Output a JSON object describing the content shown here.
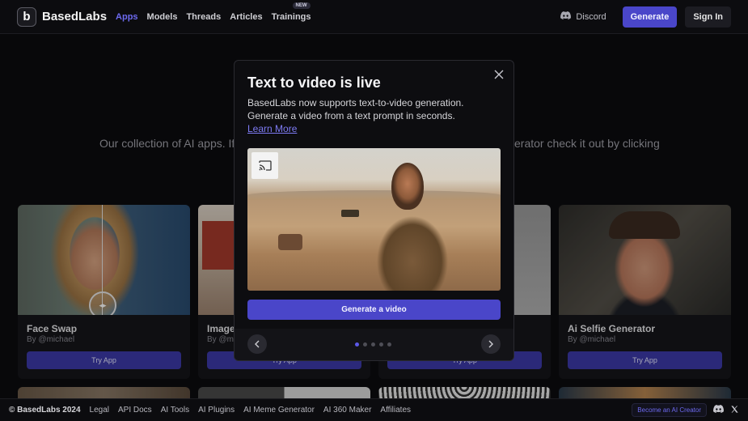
{
  "brand": {
    "name": "BasedLabs"
  },
  "nav": {
    "items": [
      {
        "label": "Apps",
        "active": true
      },
      {
        "label": "Models"
      },
      {
        "label": "Threads"
      },
      {
        "label": "Articles"
      },
      {
        "label": "Trainings",
        "badge": "NEW"
      }
    ]
  },
  "header_actions": {
    "discord": "Discord",
    "generate": "Generate",
    "signin": "Sign In"
  },
  "intro": {
    "left_text": "Our collection of AI apps. If y",
    "right_text": "erator check it out by clicking"
  },
  "cards": [
    {
      "title": "Face Swap",
      "author": "By @michael",
      "button": "Try App"
    },
    {
      "title": "Image",
      "author": "By @mi",
      "button": "Try App"
    },
    {
      "title": "",
      "author": "",
      "button": "Try App"
    },
    {
      "title": "Ai Selfie Generator",
      "author": "By @michael",
      "button": "Try App"
    }
  ],
  "modal": {
    "title": "Text to video is live",
    "description": "BasedLabs now supports text-to-video generation. Generate a video from a text prompt in seconds.",
    "learn_more": "Learn More",
    "cta": "Generate a video",
    "slides_total": 5,
    "slide_active": 1
  },
  "footer": {
    "copyright": "© BasedLabs 2024",
    "links": [
      "Legal",
      "API Docs",
      "AI Tools",
      "AI Plugins",
      "AI Meme Generator",
      "AI 360 Maker",
      "Affiliates"
    ],
    "creator_button": "Become an AI Creator"
  },
  "colors": {
    "accent": "#4a46c9",
    "link": "#7e7bf4",
    "background": "#0c0c0f"
  }
}
